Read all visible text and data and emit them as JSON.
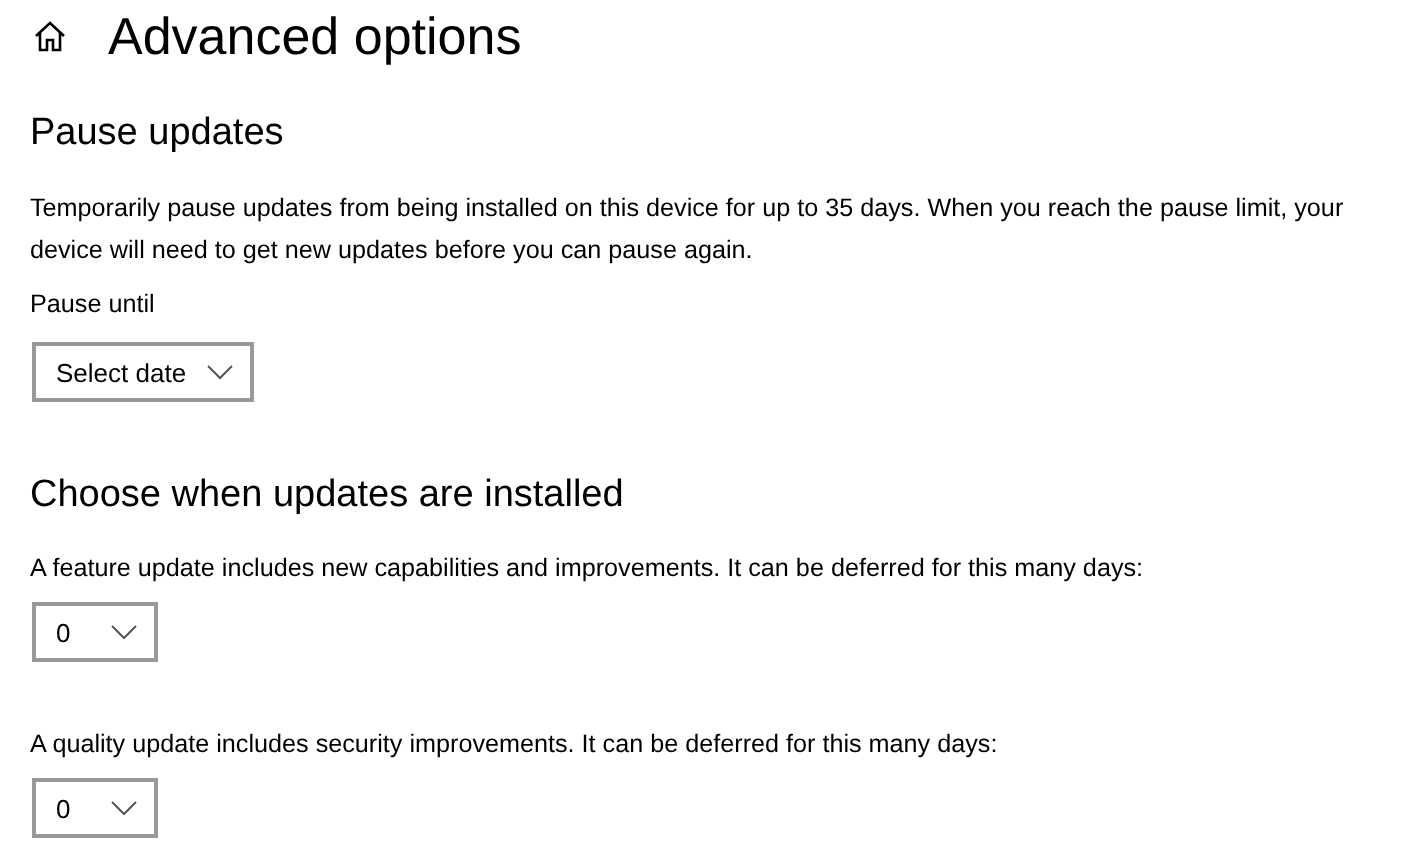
{
  "page": {
    "title": "Advanced options"
  },
  "pause_updates": {
    "heading": "Pause updates",
    "description": "Temporarily pause updates from being installed on this device for up to 35 days. When you reach the pause limit, your device will need to get new updates before you can pause again.",
    "field_label": "Pause until",
    "dropdown": {
      "value": "Select date"
    }
  },
  "choose_when": {
    "heading": "Choose when updates are installed",
    "settings": [
      {
        "label": "A feature update includes new capabilities and improvements. It can be deferred for this many days:",
        "value": "0"
      },
      {
        "label": "A quality update includes security improvements. It can be deferred for this many days:",
        "value": "0"
      }
    ]
  }
}
